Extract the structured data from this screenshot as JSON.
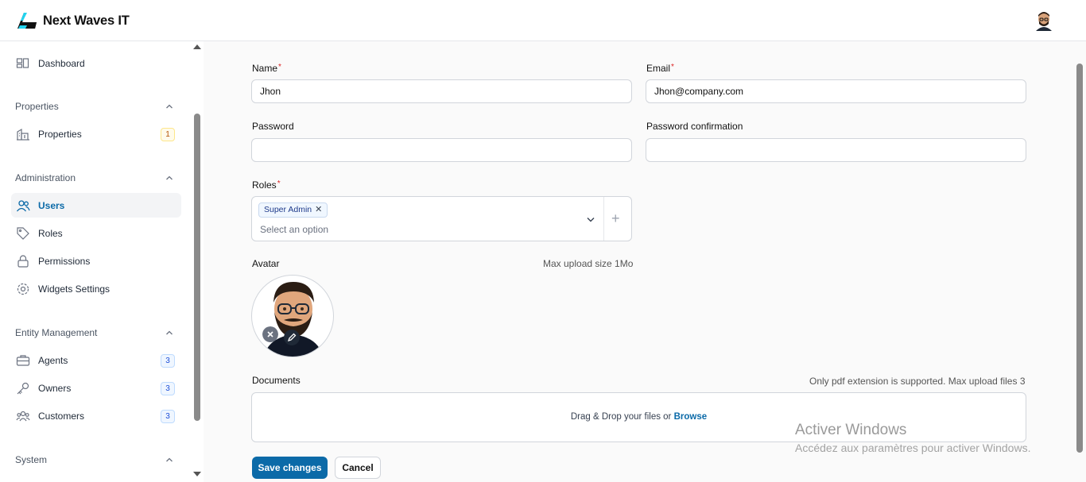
{
  "app": {
    "brand": "Next Waves IT"
  },
  "sidebar": {
    "dashboard": "Dashboard",
    "groups": [
      {
        "label": "Properties"
      },
      {
        "label": "Administration"
      },
      {
        "label": "Entity Management"
      },
      {
        "label": "System"
      }
    ],
    "items": {
      "properties": {
        "label": "Properties",
        "badge": "1"
      },
      "users": {
        "label": "Users"
      },
      "roles": {
        "label": "Roles"
      },
      "permissions": {
        "label": "Permissions"
      },
      "widgets": {
        "label": "Widgets Settings"
      },
      "agents": {
        "label": "Agents",
        "badge": "3"
      },
      "owners": {
        "label": "Owners",
        "badge": "3"
      },
      "customers": {
        "label": "Customers",
        "badge": "3"
      }
    }
  },
  "form": {
    "name": {
      "label": "Name",
      "required": "*",
      "value": "Jhon"
    },
    "email": {
      "label": "Email",
      "required": "*",
      "value": "Jhon@company.com"
    },
    "password": {
      "label": "Password",
      "value": ""
    },
    "password_confirmation": {
      "label": "Password confirmation",
      "value": ""
    },
    "roles": {
      "label": "Roles",
      "required": "*",
      "selected": "Super Admin",
      "remove": "✕",
      "placeholder": "Select an option",
      "add": "+"
    },
    "avatar": {
      "label": "Avatar",
      "hint": "Max upload size 1Mo"
    },
    "documents": {
      "label": "Documents",
      "hint": "Only pdf extension is supported. Max upload files 3",
      "drop_text": "Drag & Drop your files or ",
      "browse": "Browse"
    },
    "save": "Save changes",
    "cancel": "Cancel"
  },
  "watermark": {
    "title": "Activer Windows",
    "subtitle": "Accédez aux paramètres pour activer Windows."
  },
  "colors": {
    "accent": "#0b6aa8",
    "required": "#dc2626"
  }
}
